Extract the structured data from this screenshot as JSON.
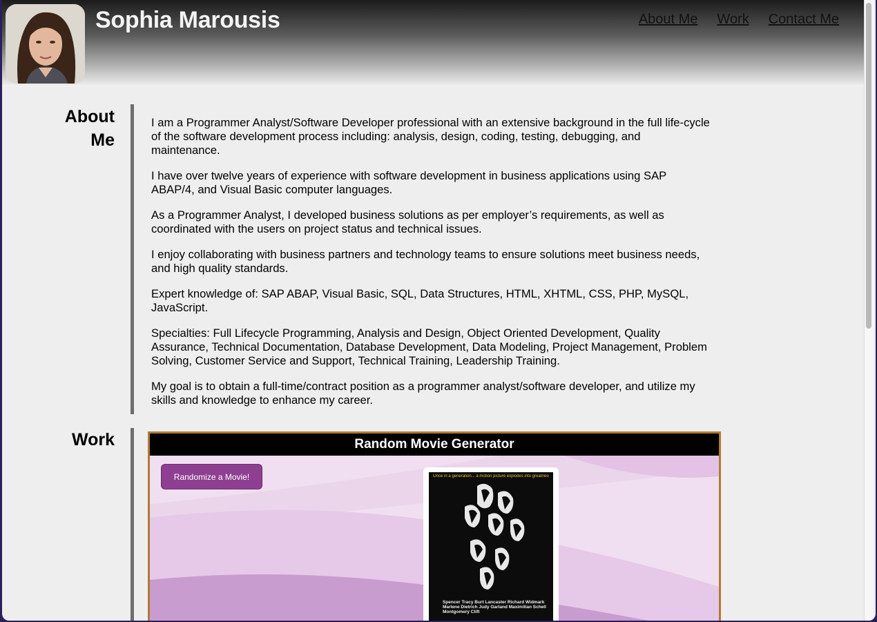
{
  "header": {
    "name": "Sophia Marousis",
    "nav": [
      "About Me",
      "Work",
      "Contact Me"
    ]
  },
  "about": {
    "heading_line1": "About",
    "heading_line2": "Me",
    "paragraphs": [
      "I am a Programmer Analyst/Software Developer professional with an extensive background in the full life-cycle of the software development process including: analysis, design, coding, testing, debugging, and maintenance.",
      "I have over twelve years of experience with software development in business applications using SAP ABAP/4, and Visual Basic computer languages.",
      "As a Programmer Analyst, I developed business solutions as per employer’s requirements, as well as coordinated with the users on project status and technical issues.",
      "I enjoy collaborating with business partners and technology teams to ensure solutions meet business needs, and high quality standards.",
      "Expert knowledge of: SAP ABAP, Visual Basic, SQL, Data Structures, HTML, XHTML, CSS, PHP, MySQL, JavaScript.",
      "Specialties: Full Lifecycle Programming, Analysis and Design, Object Oriented Development, Quality Assurance, Technical Documentation, Database Development, Data Modeling, Project Management, Problem Solving, Customer Service and Support, Technical Training, Leadership Training.",
      "My goal is to obtain a full-time/contract position as a programmer analyst/software developer, and utilize my skills and knowledge to enhance my career."
    ]
  },
  "work": {
    "heading": "Work",
    "project": {
      "title": "Random Movie Generator",
      "button_label": "Randomize a Movie!",
      "poster_tagline": "Once in a generation... a motion picture explodes into greatness!",
      "poster_credits": "Spencer Tracy  Burt Lancaster  Richard Widmark  Marlene Dietrich  Judy Garland  Maximilian Schell  Montgomery Clift"
    }
  },
  "colors": {
    "button": "#8e3f91",
    "project_border": "#b07a35",
    "sidebar_bar": "#6e6e6e"
  }
}
